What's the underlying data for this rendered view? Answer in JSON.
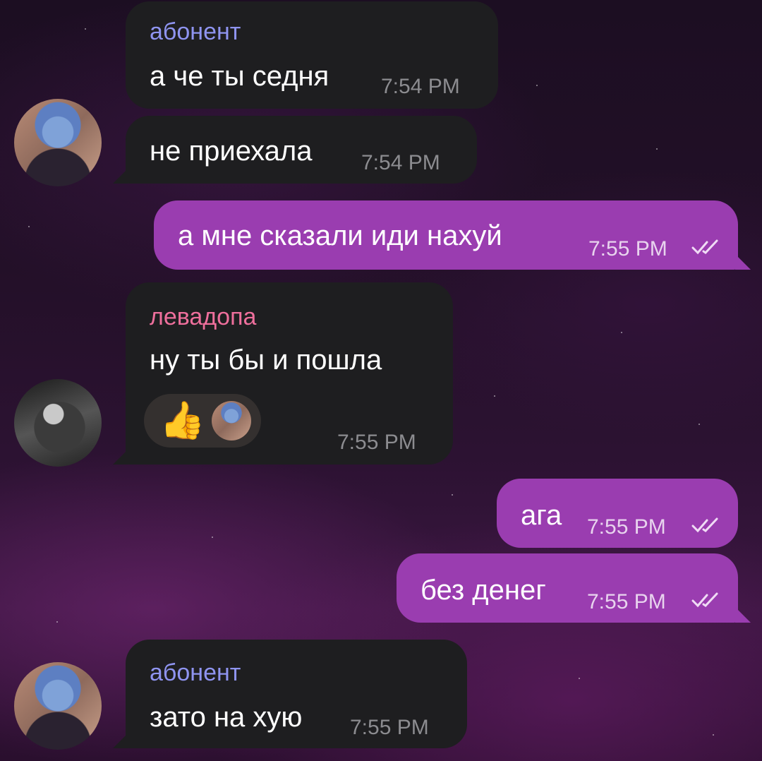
{
  "colors": {
    "incoming_bubble": "#1e1e20",
    "outgoing_bubble": "#9a3db0",
    "sender_abonent": "#8f94f0",
    "sender_levadopa": "#ee6f9c",
    "incoming_time": "#8c8c90",
    "outgoing_time": "#e8d3ee"
  },
  "messages": [
    {
      "sender": "абонент",
      "text": "а че ты седня",
      "time": "7:54 PM"
    },
    {
      "text": "не приехала",
      "time": "7:54 PM"
    },
    {
      "text": "а мне сказали иди нахуй",
      "time": "7:55 PM",
      "status_icon": "double-check-icon"
    },
    {
      "sender": "левадопа",
      "text": "ну ты бы и пошла",
      "time": "7:55 PM",
      "reaction": {
        "emoji": "👍",
        "icon": "thumbs-up-icon"
      }
    },
    {
      "text": "ага",
      "time": "7:55 PM",
      "status_icon": "double-check-icon"
    },
    {
      "text": "без денег",
      "time": "7:55 PM",
      "status_icon": "double-check-icon"
    },
    {
      "sender": "абонент",
      "text": "зато на хую",
      "time": "7:55 PM"
    }
  ]
}
